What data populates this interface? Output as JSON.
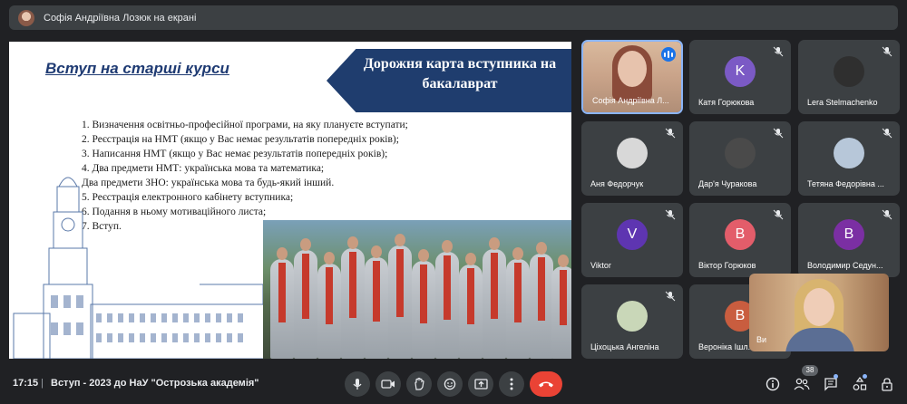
{
  "banner": {
    "text": "Софія Андріївна Лозюк на екрані"
  },
  "slide": {
    "heading": "Вступ на старші курси",
    "arrow_title": "Дорожня карта вступника на бакалаврат",
    "steps": [
      "1.   Визначення освітньо-професійної програми, на яку плануєте вступати;",
      "2.   Реєстрація на НМТ (якщо у Вас немає результатів попередніх років);",
      "3.   Написання НМТ (якщо у Вас немає результатів попередніх років);",
      "4.   Два предмети НМТ: українська мова та математика;",
      "       Два предмети ЗНО: українська мова та будь-який інший.",
      "5.   Реєстрація електронного кабінету вступника;",
      "6.   Подання в ньому мотиваційного листа;",
      "7.    Вступ."
    ]
  },
  "participants": [
    {
      "name": "Софія Андріївна Л...",
      "kind": "video",
      "active": true
    },
    {
      "name": "Катя Горюкова",
      "kind": "letter",
      "letter": "K",
      "color": "#7b5ac5"
    },
    {
      "name": "Lera Stelmachenko",
      "kind": "photo",
      "color": "#2f2f2f"
    },
    {
      "name": "Аня Федорчук",
      "kind": "photo",
      "color": "#d8d8d8"
    },
    {
      "name": "Дар'я Чуракова",
      "kind": "photo",
      "color": "#4a4a4a"
    },
    {
      "name": "Тетяна Федорівна ...",
      "kind": "photo",
      "color": "#b7c7d9"
    },
    {
      "name": "Viktor",
      "kind": "letter",
      "letter": "V",
      "color": "#5e35b1"
    },
    {
      "name": "Віктор Горюков",
      "kind": "letter",
      "letter": "В",
      "color": "#e35d6a"
    },
    {
      "name": "Володимир Седун...",
      "kind": "letter",
      "letter": "В",
      "color": "#7b2fa3"
    },
    {
      "name": "Ціхоцька Ангеліна",
      "kind": "photo",
      "color": "#c9d7b8"
    },
    {
      "name": "Вероніка Ішл...",
      "kind": "letter",
      "letter": "В",
      "color": "#c95d3f"
    }
  ],
  "pip": {
    "name": "Ви"
  },
  "bottom": {
    "time": "17:15",
    "separator": "|",
    "meeting_title": "Вступ - 2023 до НаУ \"Острозька академія\"",
    "participant_count": "38"
  },
  "icons": {
    "mic": "mic-icon",
    "camera": "camera-icon",
    "hand": "raise-hand-icon",
    "emoji": "emoji-icon",
    "present": "present-icon",
    "more": "more-vert-icon",
    "end": "end-call-icon",
    "info": "info-icon",
    "people": "people-icon",
    "chat": "chat-icon",
    "activities": "activities-icon",
    "lock": "host-controls-icon"
  },
  "colors": {
    "end_call": "#ea4335",
    "accent": "#8ab4f8",
    "tile_bg": "#3c4043",
    "page_bg": "#202124"
  }
}
